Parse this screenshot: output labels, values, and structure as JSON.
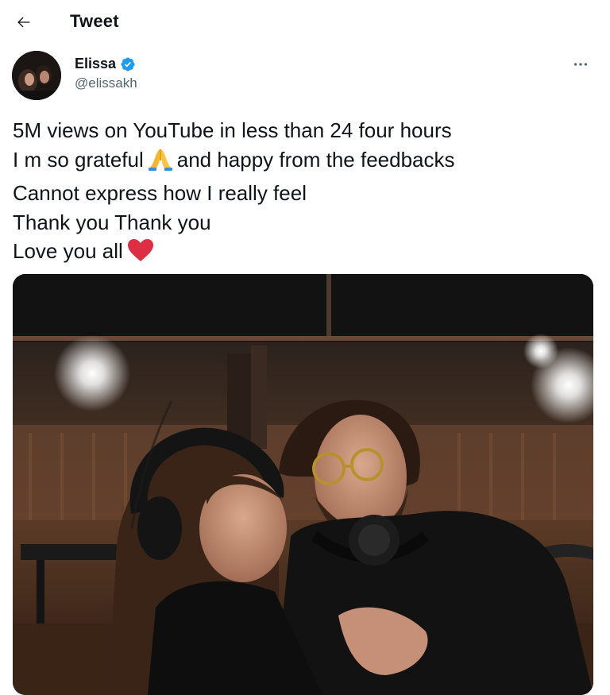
{
  "header": {
    "title": "Tweet",
    "back_icon": "arrow-left-icon"
  },
  "author": {
    "display_name": "Elissa",
    "handle": "@elissakh",
    "verified_icon": "verified-badge-icon",
    "verified_color": "#1d9bf0"
  },
  "more_icon": "more-horizontal-icon",
  "tweet": {
    "lines": [
      "5M views on YouTube in less than 24 four hours",
      "I m so grateful",
      "and happy from the feedbacks",
      "Cannot express how I really feel",
      "Thank you Thank you",
      "Love you all"
    ],
    "emojis": [
      "folded-hands-emoji",
      "red-heart-emoji"
    ]
  },
  "media": {
    "icon": "photo-studio-couple-image"
  },
  "colors": {
    "text": "#0f1419",
    "secondary": "#536471",
    "background": "#ffffff"
  }
}
